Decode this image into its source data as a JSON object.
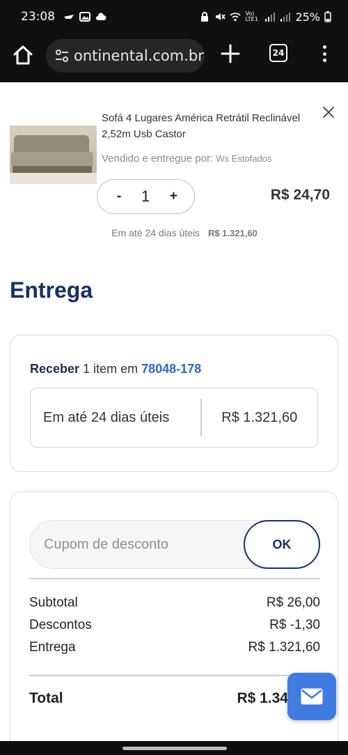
{
  "status_bar": {
    "time": "23:08",
    "battery": "25%",
    "network": "Vo) LTE1"
  },
  "browser": {
    "url": "ontinental.com.br",
    "tab_count": "24"
  },
  "product": {
    "title": "Sofá 4 Lugares América Retrátil Reclinável 2,52m Usb Castor",
    "seller_prefix": "Vendido e entregue por:",
    "seller_name": "Ws Estofados",
    "quantity": "1",
    "qty_minus": "-",
    "qty_plus": "+",
    "price": "R$ 24,70",
    "delivery_days": "Em até 24 dias úteis",
    "delivery_price": "R$ 1.321,60"
  },
  "delivery": {
    "section_title": "Entrega",
    "receive_label": "Receber",
    "receive_text": "1 item em",
    "cep": "78048-178",
    "option_days": "Em até 24 dias úteis",
    "option_price": "R$ 1.321,60"
  },
  "summary": {
    "coupon_placeholder": "Cupom de desconto",
    "coupon_button": "OK",
    "rows": [
      {
        "label": "Subtotal",
        "value": "R$ 26,00"
      },
      {
        "label": "Descontos",
        "value": "R$ -1,30"
      },
      {
        "label": "Entrega",
        "value": "R$ 1.321,60"
      }
    ],
    "total_label": "Total",
    "total_value": "R$ 1.34"
  },
  "colors": {
    "brand_navy": "#17306b",
    "link_blue": "#2f66c9",
    "fab_blue": "#3f7be0"
  },
  "icons": [
    "home-icon",
    "site-settings-icon",
    "new-tab-icon",
    "tab-switcher-icon",
    "overflow-menu-icon",
    "close-icon",
    "mail-icon"
  ]
}
